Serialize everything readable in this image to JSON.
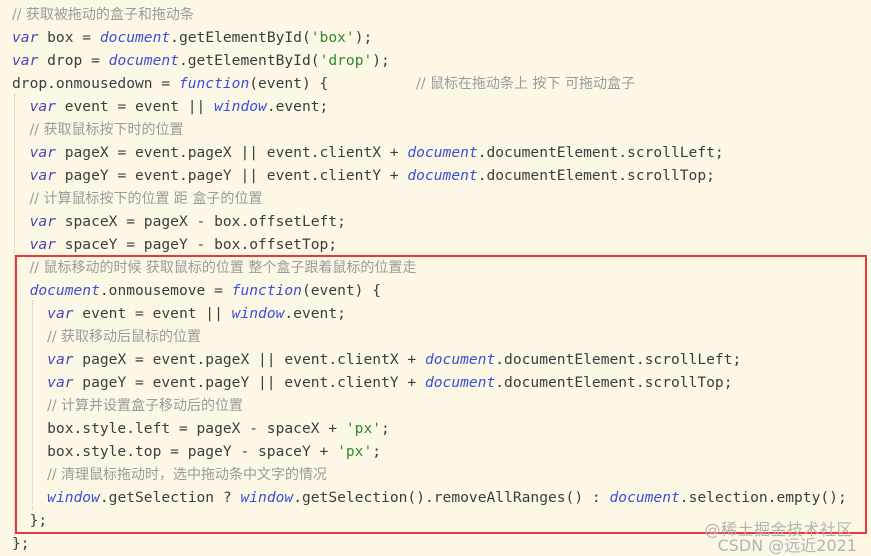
{
  "lines": [
    [
      {
        "t": "// 获取被拖动的盒子和拖动条",
        "c": "cm"
      }
    ],
    [
      {
        "t": "var",
        "c": "kw"
      },
      {
        "t": " box = "
      },
      {
        "t": "document",
        "c": "gl"
      },
      {
        "t": ".getElementById("
      },
      {
        "t": "'box'",
        "c": "str"
      },
      {
        "t": ");"
      }
    ],
    [
      {
        "t": "var",
        "c": "kw"
      },
      {
        "t": " drop = "
      },
      {
        "t": "document",
        "c": "gl"
      },
      {
        "t": ".getElementById("
      },
      {
        "t": "'drop'",
        "c": "str"
      },
      {
        "t": ");"
      }
    ],
    [
      {
        "t": "drop.onmousedown = "
      },
      {
        "t": "function",
        "c": "fn"
      },
      {
        "t": "(event) {          "
      },
      {
        "t": "// 鼠标在拖动条上 按下 可拖动盒子",
        "c": "cm"
      }
    ],
    [
      {
        "t": "  "
      },
      {
        "t": "var",
        "c": "kw"
      },
      {
        "t": " event = event || "
      },
      {
        "t": "window",
        "c": "gl"
      },
      {
        "t": ".event;"
      }
    ],
    [
      {
        "t": "  "
      },
      {
        "t": "// 获取鼠标按下时的位置",
        "c": "cm"
      }
    ],
    [
      {
        "t": "  "
      },
      {
        "t": "var",
        "c": "kw"
      },
      {
        "t": " pageX = event.pageX || event.clientX + "
      },
      {
        "t": "document",
        "c": "gl"
      },
      {
        "t": ".documentElement.scrollLeft;"
      }
    ],
    [
      {
        "t": "  "
      },
      {
        "t": "var",
        "c": "kw"
      },
      {
        "t": " pageY = event.pageY || event.clientY + "
      },
      {
        "t": "document",
        "c": "gl"
      },
      {
        "t": ".documentElement.scrollTop;"
      }
    ],
    [
      {
        "t": "  "
      },
      {
        "t": "// 计算鼠标按下的位置 距 盒子的位置",
        "c": "cm"
      }
    ],
    [
      {
        "t": "  "
      },
      {
        "t": "var",
        "c": "kw"
      },
      {
        "t": " spaceX = pageX - box.offsetLeft;"
      }
    ],
    [
      {
        "t": "  "
      },
      {
        "t": "var",
        "c": "kw"
      },
      {
        "t": " spaceY = pageY - box.offsetTop;"
      }
    ],
    [
      {
        "t": "  "
      },
      {
        "t": "// 鼠标移动的时候 获取鼠标的位置 整个盒子跟着鼠标的位置走",
        "c": "cm"
      }
    ],
    [
      {
        "t": "  "
      },
      {
        "t": "document",
        "c": "gl"
      },
      {
        "t": ".onmousemove = "
      },
      {
        "t": "function",
        "c": "fn"
      },
      {
        "t": "(event) {"
      }
    ],
    [
      {
        "t": "    "
      },
      {
        "t": "var",
        "c": "kw"
      },
      {
        "t": " event = event || "
      },
      {
        "t": "window",
        "c": "gl"
      },
      {
        "t": ".event;"
      }
    ],
    [
      {
        "t": "    "
      },
      {
        "t": "// 获取移动后鼠标的位置",
        "c": "cm"
      }
    ],
    [
      {
        "t": "    "
      },
      {
        "t": "var",
        "c": "kw"
      },
      {
        "t": " pageX = event.pageX || event.clientX + "
      },
      {
        "t": "document",
        "c": "gl"
      },
      {
        "t": ".documentElement.scrollLeft;"
      }
    ],
    [
      {
        "t": "    "
      },
      {
        "t": "var",
        "c": "kw"
      },
      {
        "t": " pageY = event.pageY || event.clientY + "
      },
      {
        "t": "document",
        "c": "gl"
      },
      {
        "t": ".documentElement.scrollTop;"
      }
    ],
    [
      {
        "t": "    "
      },
      {
        "t": "// 计算并设置盒子移动后的位置",
        "c": "cm"
      }
    ],
    [
      {
        "t": "    box.style.left = pageX - spaceX + "
      },
      {
        "t": "'px'",
        "c": "str"
      },
      {
        "t": ";"
      }
    ],
    [
      {
        "t": "    box.style.top = pageY - spaceY + "
      },
      {
        "t": "'px'",
        "c": "str"
      },
      {
        "t": ";"
      }
    ],
    [
      {
        "t": "    "
      },
      {
        "t": "// 清理鼠标拖动时，选中拖动条中文字的情况",
        "c": "cm"
      }
    ],
    [
      {
        "t": "    "
      },
      {
        "t": "window",
        "c": "gl"
      },
      {
        "t": ".getSelection ? "
      },
      {
        "t": "window",
        "c": "gl"
      },
      {
        "t": ".getSelection().removeAllRanges() : "
      },
      {
        "t": "document",
        "c": "gl"
      },
      {
        "t": ".selection.empty();"
      }
    ],
    [
      {
        "t": "  };"
      }
    ],
    [
      {
        "t": "};"
      }
    ]
  ],
  "watermark": {
    "line1": "@稀土掘金技术社区",
    "line2": "CSDN @远近2021"
  },
  "colors": {
    "background": "#fdf8e6",
    "keyword": "#4b43b5",
    "global": "#3a4fd8",
    "string": "#2f8a2f",
    "comment": "#9a9a9a",
    "highlight_border": "#e53a3a"
  }
}
